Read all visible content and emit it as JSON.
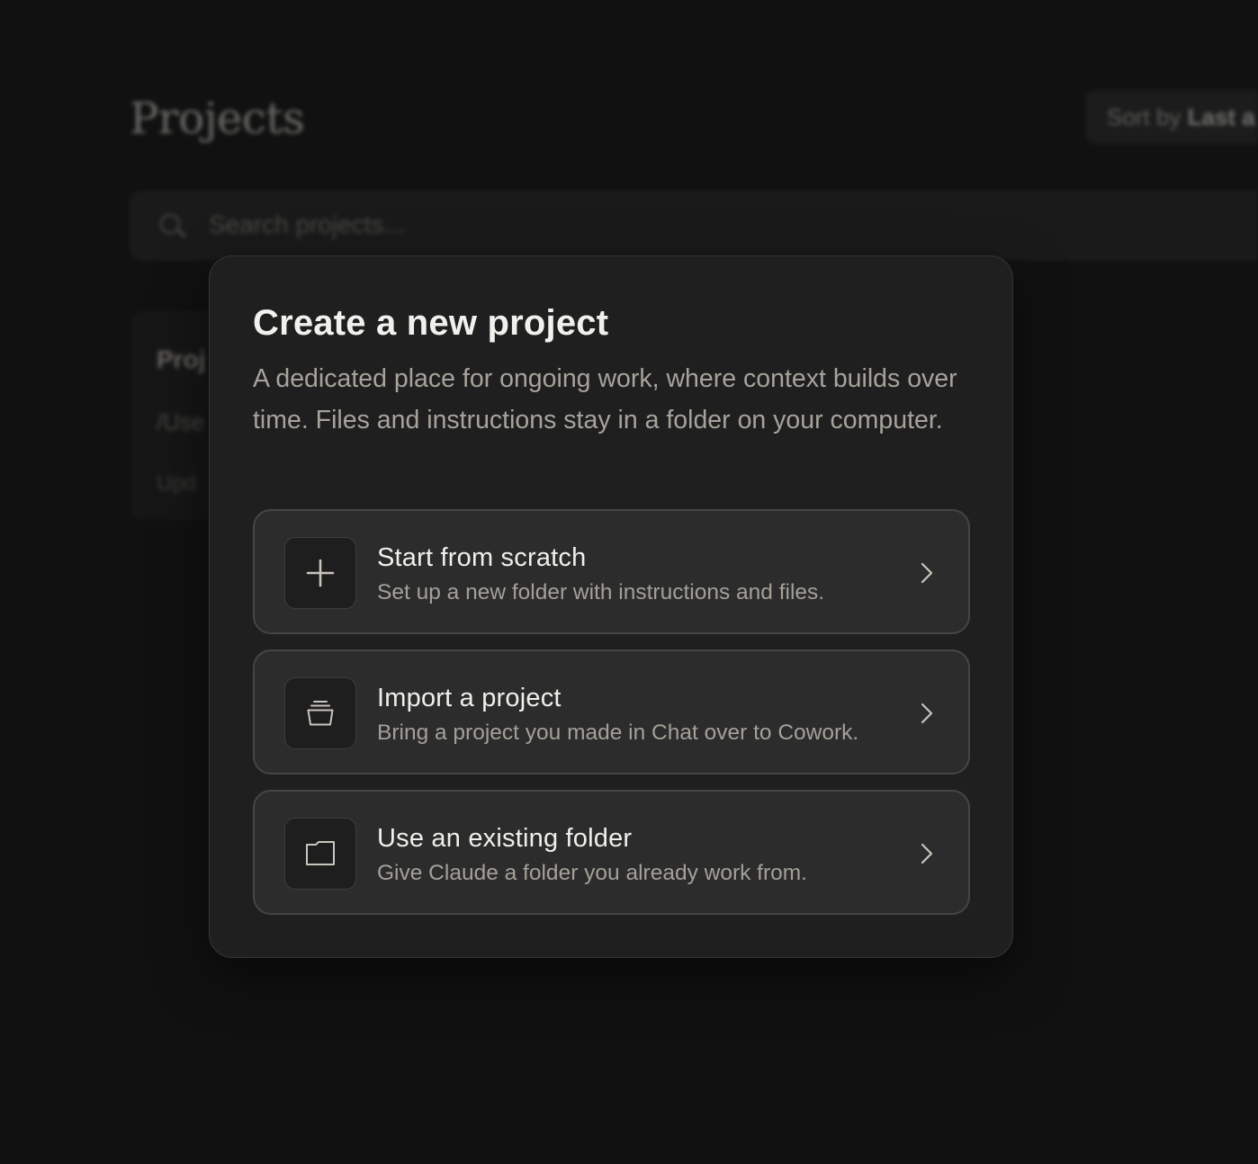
{
  "background": {
    "page_title": "Projects",
    "sort": {
      "prefix": "Sort by",
      "value": "Last a"
    },
    "search_placeholder": "Search projects...",
    "card": {
      "title": "Proj",
      "path": "/Use",
      "updated": "Upd"
    }
  },
  "modal": {
    "title": "Create a new project",
    "description": "A dedicated place for ongoing work, where context builds over time. Files and instructions stay in a folder on your computer.",
    "options": [
      {
        "icon": "plus-icon",
        "title": "Start from scratch",
        "subtitle": "Set up a new folder with instructions and files."
      },
      {
        "icon": "archive-box-icon",
        "title": "Import a project",
        "subtitle": "Bring a project you made in Chat over to Cowork."
      },
      {
        "icon": "folder-icon",
        "title": "Use an existing folder",
        "subtitle": "Give Claude a folder you already work from."
      }
    ]
  },
  "colors": {
    "page_background": "#111111",
    "modal_background": "#1f1f1f",
    "option_background": "#2c2c2c",
    "option_border": "#454545",
    "title_text": "#f2f0ec",
    "secondary_text": "#a7a39c"
  }
}
